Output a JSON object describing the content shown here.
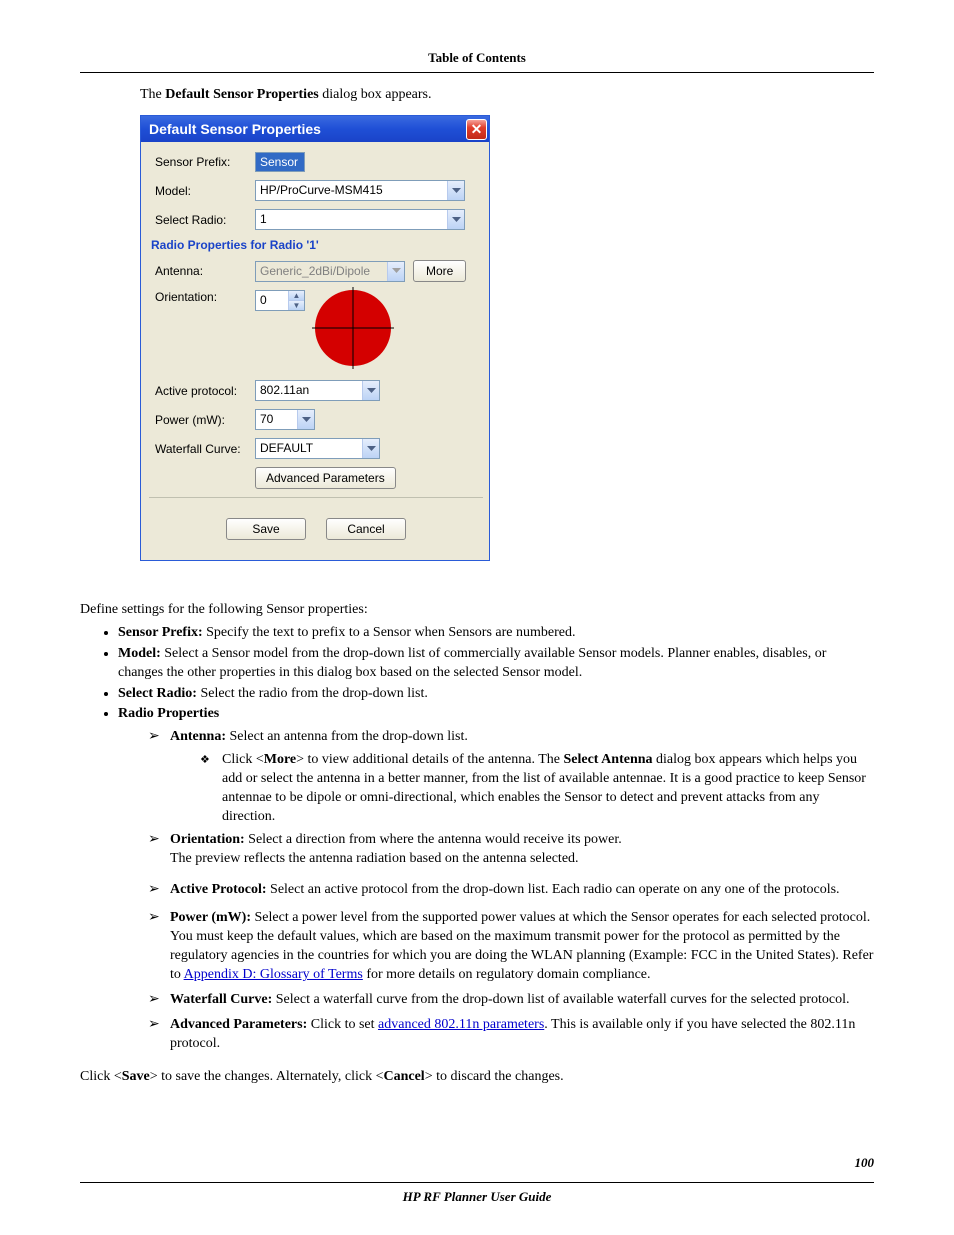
{
  "header": {
    "title": "Table of Contents"
  },
  "intro": {
    "prefix": "The ",
    "bold": "Default Sensor Properties",
    "suffix": " dialog box appears."
  },
  "dialog": {
    "title": "Default Sensor Properties",
    "labels": {
      "sensor_prefix": "Sensor Prefix:",
      "model": "Model:",
      "select_radio": "Select Radio:",
      "radio_group": "Radio Properties for Radio '1'",
      "antenna": "Antenna:",
      "orientation": "Orientation:",
      "active_protocol": "Active protocol:",
      "power": "Power (mW):",
      "waterfall": "Waterfall Curve:"
    },
    "values": {
      "sensor_prefix": "Sensor",
      "model": "HP/ProCurve-MSM415",
      "select_radio": "1",
      "antenna": "Generic_2dBi/Dipole",
      "orientation": "0",
      "active_protocol": "802.11an",
      "power": "70",
      "waterfall": "DEFAULT"
    },
    "buttons": {
      "more": "More",
      "advanced": "Advanced Parameters",
      "save": "Save",
      "cancel": "Cancel"
    }
  },
  "body": {
    "define_line": "Define settings for the following Sensor properties:",
    "bullets": {
      "sensor_prefix": {
        "label": "Sensor Prefix:",
        "text": " Specify the text to prefix to a Sensor when Sensors are numbered."
      },
      "model": {
        "label": "Model:",
        "text": " Select a Sensor model from the drop-down list of commercially available Sensor models. Planner enables, disables, or changes the other properties in this dialog box based on the selected Sensor model."
      },
      "select_radio": {
        "label": "Select Radio:",
        "text": " Select the radio from the drop-down list."
      },
      "radio_props": {
        "label": "Radio Properties"
      }
    },
    "radio": {
      "antenna": {
        "label": "Antenna:",
        "text": " Select an antenna from the drop-down list."
      },
      "antenna_more": {
        "pre": "Click <",
        "more": "More",
        "mid": "> to view additional details of the antenna. The ",
        "dlg": "Select Antenna",
        "post": " dialog box appears which helps you add or select the antenna in a better manner, from the list of available antennae. It is a good practice to keep Sensor antennae to be dipole or omni-directional, which enables the Sensor to detect and prevent attacks from any direction."
      },
      "orientation": {
        "label": "Orientation:",
        "text": " Select a direction from where the antenna would receive its power.",
        "text2": "The preview reflects the antenna radiation based on the antenna selected."
      },
      "active_protocol": {
        "label": "Active Protocol:",
        "text": " Select an active protocol from the drop-down list. Each radio can operate on any one of the protocols."
      },
      "power": {
        "label": "Power (mW):",
        "text_a": " Select a power level from the supported power values at which the Sensor operates for each selected protocol. You must keep the default values, which are based on the maximum transmit power for the protocol as permitted by the regulatory agencies in the countries for which you are doing the WLAN planning (Example: FCC in the United States). Refer to ",
        "link": "Appendix D: Glossary of Terms",
        "text_b": " for more details on regulatory domain compliance."
      },
      "waterfall": {
        "label": "Waterfall Curve:",
        "text": " Select a waterfall curve from the drop-down list of available waterfall curves for the selected protocol."
      },
      "advanced": {
        "label": "Advanced Parameters:",
        "text_a": " Click to set ",
        "link": "advanced 802.11n parameters",
        "text_b": ". This is available only if you have selected the 802.11n protocol."
      }
    },
    "save_line": {
      "a": "Click <",
      "save": "Save",
      "b": "> to save the changes. Alternately, click <",
      "cancel": "Cancel",
      "c": "> to discard the changes."
    }
  },
  "footer": {
    "page": "100",
    "title": "HP RF Planner User Guide"
  }
}
